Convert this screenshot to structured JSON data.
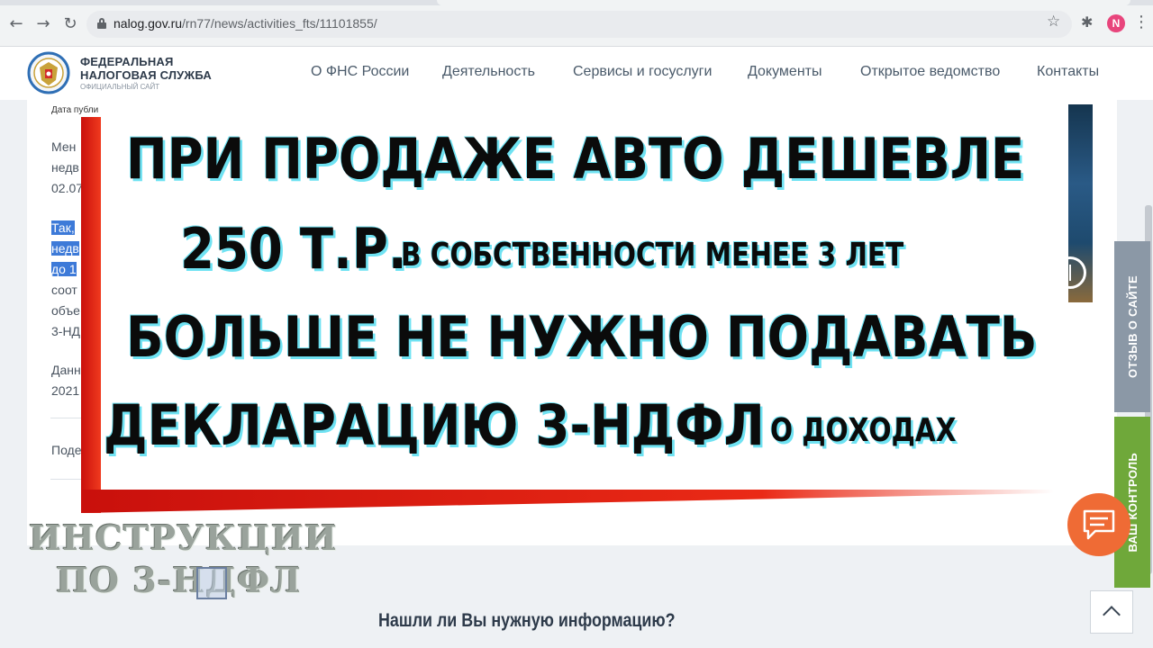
{
  "browser": {
    "url_domain": "nalog.gov.ru",
    "url_path": "/rn77/news/activities_fts/11101855/",
    "profile_initial": "N",
    "icons": [
      "back-arrow-icon",
      "forward-arrow-icon",
      "reload-icon",
      "lock-icon",
      "star-icon",
      "puzzle-icon",
      "kebab-menu-icon"
    ]
  },
  "site": {
    "brand_line1": "ФЕДЕРАЛЬНАЯ",
    "brand_line2": "НАЛОГОВАЯ СЛУЖБА",
    "brand_line3": "ОФИЦИАЛЬНЫЙ САЙТ",
    "nav": [
      "О ФНС России",
      "Деятельность",
      "Сервисы и госуслуги",
      "Документы",
      "Открытое ведомство",
      "Контакты"
    ]
  },
  "article_fragments": {
    "date_label": "Дата публи",
    "p1": [
      "Мен",
      "недв",
      "02.07"
    ],
    "p2_highlighted": [
      "Так,",
      "недв",
      "до 1"
    ],
    "p2": [
      "соот",
      "объе",
      "3-НД"
    ],
    "p3": [
      "Данн",
      "2021"
    ],
    "share": "Поде"
  },
  "overlay": {
    "line1": "ПРИ ПРОДАЖЕ АВТО ДЕШЕВЛЕ",
    "line2_big": "250 Т.Р.",
    "line2_small": "В СОБСТВЕННОСТИ МЕНЕЕ 3 ЛЕТ",
    "line3": "БОЛЬШЕ НЕ НУЖНО ПОДАВАТЬ",
    "line4_big": "ДЕКЛАРАЦИЮ 3-НДФЛ",
    "line4_small": "О ДОХОДАХ"
  },
  "watermark": {
    "line1": "ИНСТРУКЦИИ",
    "line2": "ПО 3-НДФЛ"
  },
  "side_tabs": {
    "feedback": "ОТЗЫВ О САЙТЕ",
    "control": "ВАШ КОНТРОЛЬ"
  },
  "footer": {
    "question": "Нашли ли Вы нужную информацию?"
  },
  "colors": {
    "accent_red": "#e3200f",
    "highlight_blue": "#3d7ad8",
    "feedback_tab": "#8b98a6",
    "control_tab": "#6fa83a",
    "chat_button": "#ef6b35",
    "text_shadow_cyan": "#6fe2f2"
  }
}
